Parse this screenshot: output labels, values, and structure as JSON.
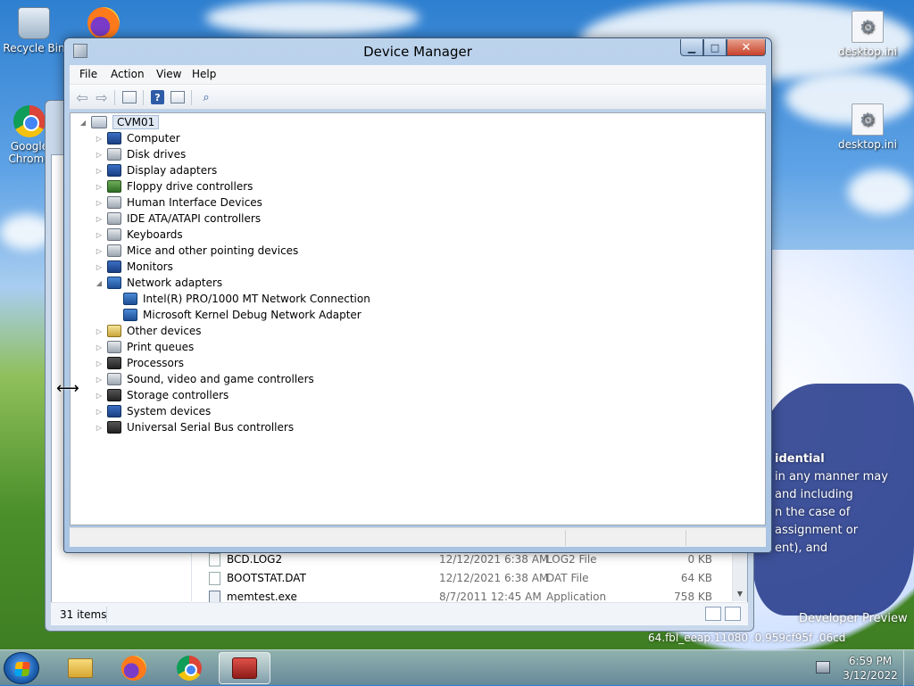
{
  "desktop": {
    "icons": [
      {
        "label": "Recycle Bin"
      },
      {
        "label": "Google Chrome"
      },
      {
        "label": "desktop.ini"
      },
      {
        "label": "desktop.ini"
      }
    ],
    "overlay_lines": [
      "idential",
      "in any manner may",
      "and including",
      "n the case of",
      "assignment or",
      "ent), and"
    ],
    "developer_preview": "Developer Preview",
    "build_string": "64.fbl_eeap.11080 .0.959cf95f .06cd"
  },
  "explorer": {
    "files": [
      {
        "name": "BCD.LOG2",
        "date": "12/12/2021 6:38 AM",
        "type": "LOG2 File",
        "size": "0 KB"
      },
      {
        "name": "BOOTSTAT.DAT",
        "date": "12/12/2021 6:38 AM",
        "type": "DAT File",
        "size": "64 KB"
      },
      {
        "name": "memtest.exe",
        "date": "8/7/2011 12:45 AM",
        "type": "Application",
        "size": "758 KB"
      }
    ],
    "item_count": "31 items"
  },
  "device_manager": {
    "title": "Device Manager",
    "menu": [
      "File",
      "Action",
      "View",
      "Help"
    ],
    "root": "CVM01",
    "categories": [
      {
        "label": "Computer",
        "expanded": false,
        "icon": "computer-icon"
      },
      {
        "label": "Disk drives",
        "expanded": false,
        "icon": "disk-drive-icon"
      },
      {
        "label": "Display adapters",
        "expanded": false,
        "icon": "display-adapter-icon"
      },
      {
        "label": "Floppy drive controllers",
        "expanded": false,
        "icon": "floppy-controller-icon"
      },
      {
        "label": "Human Interface Devices",
        "expanded": false,
        "icon": "hid-icon"
      },
      {
        "label": "IDE ATA/ATAPI controllers",
        "expanded": false,
        "icon": "ide-controller-icon"
      },
      {
        "label": "Keyboards",
        "expanded": false,
        "icon": "keyboard-icon"
      },
      {
        "label": "Mice and other pointing devices",
        "expanded": false,
        "icon": "mouse-icon"
      },
      {
        "label": "Monitors",
        "expanded": false,
        "icon": "monitor-icon"
      },
      {
        "label": "Network adapters",
        "expanded": true,
        "icon": "network-adapter-icon"
      },
      {
        "label": "Other devices",
        "expanded": false,
        "icon": "other-devices-icon"
      },
      {
        "label": "Print queues",
        "expanded": false,
        "icon": "printer-icon"
      },
      {
        "label": "Processors",
        "expanded": false,
        "icon": "processor-icon"
      },
      {
        "label": "Sound, video and game controllers",
        "expanded": false,
        "icon": "sound-icon"
      },
      {
        "label": "Storage controllers",
        "expanded": false,
        "icon": "storage-controller-icon"
      },
      {
        "label": "System devices",
        "expanded": false,
        "icon": "system-devices-icon"
      },
      {
        "label": "Universal Serial Bus controllers",
        "expanded": false,
        "icon": "usb-icon"
      }
    ],
    "network_children": [
      {
        "label": "Intel(R) PRO/1000 MT Network Connection"
      },
      {
        "label": "Microsoft Kernel Debug Network Adapter"
      }
    ]
  },
  "taskbar": {
    "time": "6:59 PM",
    "date": "3/12/2022"
  }
}
